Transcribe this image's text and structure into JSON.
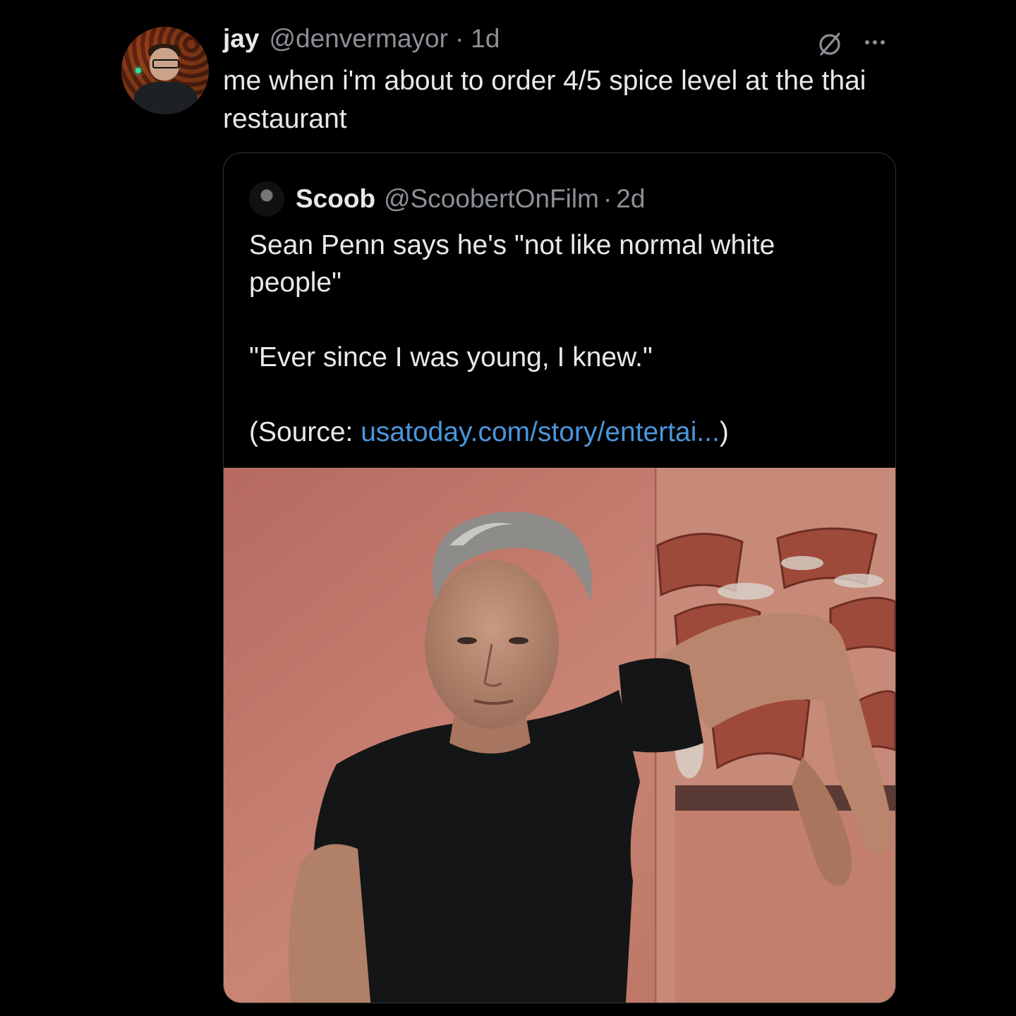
{
  "tweet": {
    "author_name": "jay",
    "author_handle": "@denvermayor",
    "separator": "·",
    "time": "1d",
    "text": "me when i'm about to order 4/5 spice level at the thai restaurant"
  },
  "quoted_tweet": {
    "author_name": "Scoob",
    "author_handle": "@ScoobertOnFilm",
    "separator": "·",
    "time": "2d",
    "line1": "Sean Penn says he's \"not like normal white people\"",
    "line2": "\"Ever since I was young, I knew.\"",
    "source_prefix": "(Source: ",
    "source_link": "usatoday.com/story/entertai...",
    "source_suffix": ")"
  },
  "icons": {
    "grok": "grok-icon",
    "more": "more-icon"
  },
  "colors": {
    "background": "#000000",
    "text": "#e7e9ea",
    "muted": "#8b9096",
    "link": "#4b96dc",
    "border": "#2f3336"
  }
}
